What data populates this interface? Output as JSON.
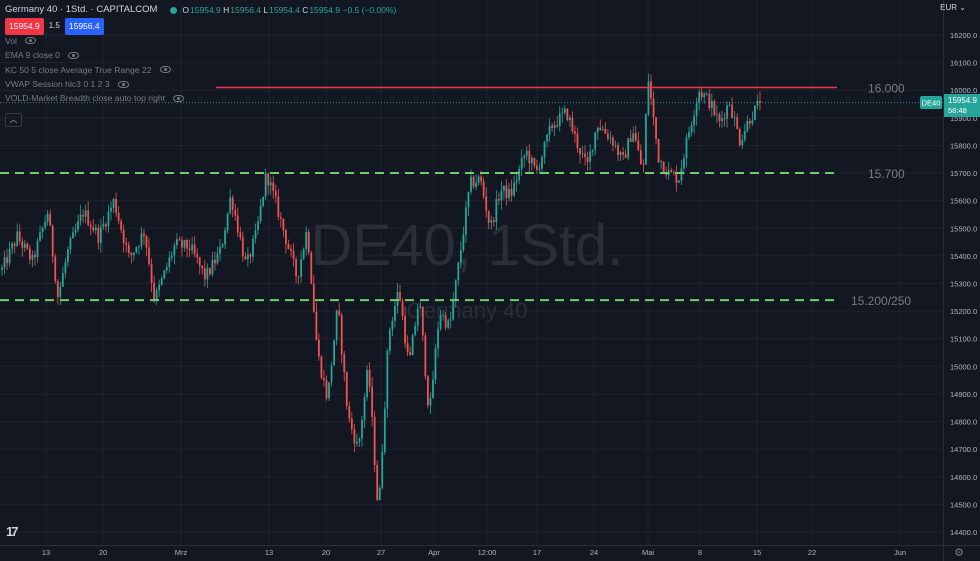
{
  "header": {
    "symbol_title": "Germany 40 · 1Std. · CAPITALCOM",
    "ohlc": [
      {
        "k": "O",
        "v": "15954.9"
      },
      {
        "k": "H",
        "v": "15956.4"
      },
      {
        "k": "L",
        "v": "15954.4"
      },
      {
        "k": "C",
        "v": "15954.9"
      }
    ],
    "change": "−0.5 (−0.00%)",
    "sell_price": "15954.9",
    "spread": "1.5",
    "buy_price": "15956.4",
    "currency": "EUR",
    "currency_arrow": "⌄"
  },
  "indicators": [
    "Vol",
    "EMA 9 close 0",
    "KC 50 5 close Average True Range 22",
    "VWAP Session hlc3 0 1 2 3",
    "VOLD-Market Breadth close auto top right"
  ],
  "collapse_label": "︿",
  "watermark": {
    "title": "DE40, 1Std.",
    "subtitle": "Germany 40"
  },
  "price_badge": {
    "symbol": "DE40",
    "price": "15954.9",
    "countdown": "58:48"
  },
  "logo_text": "17",
  "settings_glyph": "⚙",
  "colors": {
    "background": "#131722",
    "up": "#26a69a",
    "down": "#ef5350",
    "resistance": "#f23645",
    "support": "#6ccf6c",
    "axis_text": "#b2b5be"
  },
  "chart_data": {
    "type": "candlestick",
    "title": "DE40, 1Std.",
    "subtitle": "Germany 40",
    "y_axis": {
      "ticks": [
        14400,
        14500,
        14600,
        14700,
        14800,
        14900,
        15000,
        15100,
        15200,
        15300,
        15400,
        15500,
        15600,
        15700,
        15800,
        15900,
        16000,
        16100,
        16200
      ],
      "tick_labels": [
        "14400.0",
        "14500.0",
        "14600.0",
        "14700.0",
        "14800.0",
        "14900.0",
        "15000.0",
        "15100.0",
        "15200.0",
        "15300.0",
        "15400.0",
        "15500.0",
        "15600.0",
        "15700.0",
        "15800.0",
        "15900.0",
        "16000.0",
        "16100.0",
        "16200.0"
      ],
      "range": [
        14350,
        16300
      ]
    },
    "x_axis": {
      "tick_labels": [
        "13",
        "20",
        "Mrz",
        "13",
        "20",
        "27",
        "Apr",
        "12:00",
        "17",
        "24",
        "Mai",
        "8",
        "15",
        "22",
        "Jun"
      ]
    },
    "levels": [
      {
        "price": 16010,
        "label": "16.000",
        "style": "solid",
        "color": "#f23645"
      },
      {
        "price": 15700,
        "label": "15.700",
        "style": "dashed",
        "color": "#6ccf6c"
      },
      {
        "price": 15240,
        "label": "15.200/250",
        "style": "dashed",
        "color": "#6ccf6c"
      }
    ],
    "last_price": 15954.9,
    "path": [
      [
        0,
        15350
      ],
      [
        3,
        15470
      ],
      [
        6,
        15380
      ],
      [
        9,
        15560
      ],
      [
        11,
        15250
      ],
      [
        13,
        15420
      ],
      [
        16,
        15560
      ],
      [
        19,
        15470
      ],
      [
        22,
        15600
      ],
      [
        25,
        15390
      ],
      [
        28,
        15490
      ],
      [
        30,
        15240
      ],
      [
        34,
        15440
      ],
      [
        37,
        15430
      ],
      [
        40,
        15320
      ],
      [
        43,
        15420
      ],
      [
        45,
        15620
      ],
      [
        48,
        15360
      ],
      [
        50,
        15480
      ],
      [
        52,
        15700
      ],
      [
        54,
        15580
      ],
      [
        56,
        15450
      ],
      [
        58,
        15320
      ],
      [
        60,
        15500
      ],
      [
        62,
        15050
      ],
      [
        64,
        14880
      ],
      [
        66,
        15220
      ],
      [
        68,
        14820
      ],
      [
        70,
        14700
      ],
      [
        72,
        15000
      ],
      [
        74,
        14460
      ],
      [
        76,
        15120
      ],
      [
        78,
        15280
      ],
      [
        80,
        15000
      ],
      [
        82,
        15250
      ],
      [
        84,
        14820
      ],
      [
        86,
        15200
      ],
      [
        88,
        15140
      ],
      [
        90,
        15400
      ],
      [
        92,
        15660
      ],
      [
        94,
        15680
      ],
      [
        96,
        15500
      ],
      [
        98,
        15640
      ],
      [
        100,
        15620
      ],
      [
        103,
        15780
      ],
      [
        105,
        15700
      ],
      [
        108,
        15870
      ],
      [
        111,
        15920
      ],
      [
        113,
        15810
      ],
      [
        115,
        15720
      ],
      [
        117,
        15880
      ],
      [
        120,
        15820
      ],
      [
        122,
        15740
      ],
      [
        124,
        15860
      ],
      [
        126,
        15700
      ],
      [
        127,
        16050
      ],
      [
        129,
        15760
      ],
      [
        131,
        15700
      ],
      [
        133,
        15680
      ],
      [
        135,
        15850
      ],
      [
        137,
        16000
      ],
      [
        139,
        15960
      ],
      [
        141,
        15880
      ],
      [
        143,
        15960
      ],
      [
        145,
        15820
      ],
      [
        147,
        15900
      ],
      [
        149,
        15954.9
      ]
    ]
  }
}
